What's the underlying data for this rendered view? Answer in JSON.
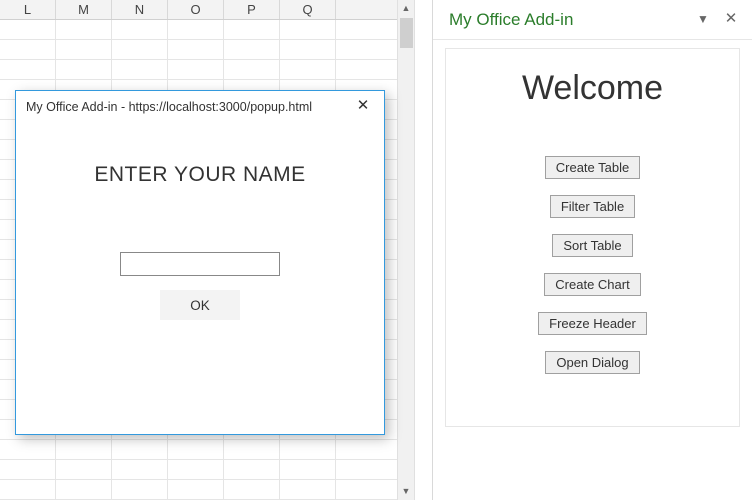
{
  "sheet": {
    "columns": [
      "L",
      "M",
      "N",
      "O",
      "P",
      "Q"
    ],
    "visible_rows": 24
  },
  "dialog": {
    "title": "My Office Add-in - https://localhost:3000/popup.html",
    "heading": "ENTER YOUR NAME",
    "input_value": "",
    "input_placeholder": "",
    "ok_label": "OK"
  },
  "taskpane": {
    "header_title": "My Office Add-in",
    "welcome": "Welcome",
    "buttons": [
      {
        "id": "create-table",
        "label": "Create Table"
      },
      {
        "id": "filter-table",
        "label": "Filter Table"
      },
      {
        "id": "sort-table",
        "label": "Sort Table"
      },
      {
        "id": "create-chart",
        "label": "Create Chart"
      },
      {
        "id": "freeze-header",
        "label": "Freeze Header"
      },
      {
        "id": "open-dialog",
        "label": "Open Dialog"
      }
    ]
  }
}
